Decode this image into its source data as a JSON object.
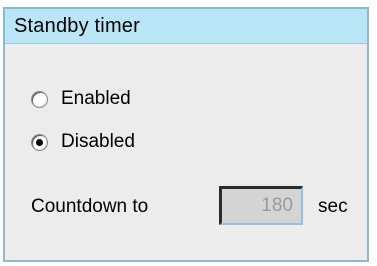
{
  "panel": {
    "title": "Standby timer"
  },
  "standby_mode": {
    "options": [
      {
        "label": "Enabled",
        "selected": false
      },
      {
        "label": "Disabled",
        "selected": true
      }
    ]
  },
  "countdown": {
    "label": "Countdown to",
    "value": "180",
    "unit": "sec",
    "editable": false
  },
  "colors": {
    "header_bg": "#b8e6f7",
    "panel_bg": "#ececec",
    "panel_border": "#8fb8cf",
    "field_bg": "#d4d4d4",
    "field_text": "#9a9a9a"
  }
}
